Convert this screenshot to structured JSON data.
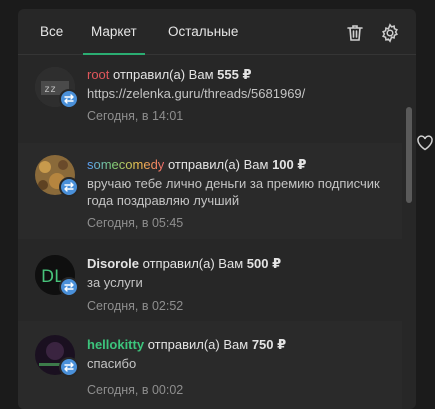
{
  "tabs": [
    {
      "label": "Все"
    },
    {
      "label": "Маркет"
    },
    {
      "label": "Остальные"
    }
  ],
  "active_tab": "Маркет",
  "toolbar": {
    "delete_icon": "trash-icon",
    "settings_icon": "gear-icon"
  },
  "colors": {
    "accent": "#2bad72",
    "badge": "#4a90d9",
    "user_root": "#e0565b",
    "user_hellokitty": "#3cc47c",
    "user_default": "#e4e4e4"
  },
  "notifications": [
    {
      "user": "root",
      "action": "отправил(а) Вам",
      "amount": "555 ₽",
      "message": "https://zelenka.guru/threads/5681969/",
      "time": "Сегодня, в 14:01"
    },
    {
      "user": "somecomedy",
      "action": "отправил(а) Вам",
      "amount": "100 ₽",
      "message": "вручаю тебе лично деньги за премию подписчик года поздравляю лучший",
      "time": "Сегодня, в 05:45"
    },
    {
      "user": "Disorole",
      "action": "отправил(а) Вам",
      "amount": "500 ₽",
      "message": "за услуги",
      "time": "Сегодня, в 02:52",
      "avatar_text": "DL"
    },
    {
      "user": "hellokitty",
      "action": "отправил(а) Вам",
      "amount": "750 ₽",
      "message": "спасибо",
      "time": "Сегодня, в 00:02"
    }
  ]
}
